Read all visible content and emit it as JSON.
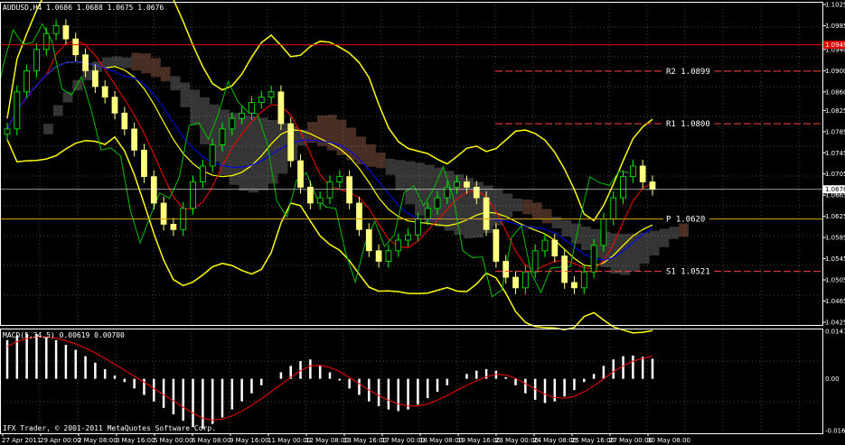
{
  "window": {
    "symbol_header": "AUDUSD,H4 1.0686 1.0688 1.0675 1.0676",
    "macd_header": "MACD(5,34,5) 0.00619 0.00700",
    "copyright": "IFX Trader, © 2001-2011 MetaQuotes Software Corp."
  },
  "colors": {
    "background": "#000000",
    "grid": "#ffffff",
    "bull_candle": "#000000",
    "bull_outline": "#00ff00",
    "bear_candle": "#ffff80",
    "bollinger": "#ffff00",
    "tenkan": "#ff0000",
    "kijun": "#0000ff",
    "chikou": "#00c000",
    "kumo_up": "#ffa07a",
    "kumo_down": "#c0c0c0",
    "resistance": "#ff4040",
    "pivot": "#d4a800",
    "current_price": "#ffffff",
    "red_level": "#e00000",
    "macd_hist": "#ffffff",
    "macd_signal": "#ff0000"
  },
  "pivots": [
    {
      "label": "R2",
      "value": "1.0899"
    },
    {
      "label": "R1",
      "value": "1.0800"
    },
    {
      "label": "P",
      "value": "1.0620"
    },
    {
      "label": "S1",
      "value": "1.0521"
    }
  ],
  "price_axis": {
    "ticks": [
      "1.1025",
      "1.0985",
      "1.0940",
      "1.0900",
      "1.0860",
      "1.0825",
      "1.0785",
      "1.0745",
      "1.0705",
      "1.0665",
      "1.0625",
      "1.0585",
      "1.0545",
      "1.0505",
      "1.0465",
      "1.0425"
    ],
    "current_price": "1.0676",
    "red_level_price": "1.0949"
  },
  "macd_axis": {
    "ticks": [
      "0.01473",
      "0.00",
      "-0.01604"
    ]
  },
  "time_axis": {
    "labels": [
      "27 Apr 2011",
      "29 Apr 00:00",
      "2 May 08:00",
      "3 May 16:00",
      "5 May 00:00",
      "6 May 08:00",
      "9 May 16:00",
      "11 May 00:00",
      "12 May 08:00",
      "13 May 16:00",
      "17 May 00:00",
      "18 May 08:00",
      "19 May 16:00",
      "23 May 00:00",
      "24 May 08:00",
      "25 May 16:00",
      "27 May 00:00",
      "30 May 08:00"
    ]
  },
  "chart_data": [
    {
      "type": "candlestick",
      "symbol": "AUDUSD",
      "timeframe": "H4",
      "ylim": [
        1.0425,
        1.1025
      ],
      "close_series": [
        1.079,
        1.086,
        1.09,
        1.094,
        1.097,
        1.0985,
        1.096,
        1.093,
        1.09,
        1.087,
        1.085,
        1.082,
        1.079,
        1.075,
        1.07,
        1.065,
        1.061,
        1.06,
        1.064,
        1.069,
        1.072,
        1.076,
        1.079,
        1.081,
        1.082,
        1.084,
        1.085,
        1.086,
        1.08,
        1.073,
        1.068,
        1.065,
        1.066,
        1.069,
        1.07,
        1.065,
        1.06,
        1.056,
        1.054,
        1.056,
        1.058,
        1.059,
        1.062,
        1.064,
        1.066,
        1.068,
        1.069,
        1.068,
        1.066,
        1.06,
        1.054,
        1.051,
        1.049,
        1.052,
        1.056,
        1.058,
        1.055,
        1.05,
        1.049,
        1.052,
        1.057,
        1.062,
        1.066,
        1.07,
        1.072,
        1.069,
        1.0676
      ],
      "pivots": {
        "R2": 1.0899,
        "R1": 1.08,
        "P": 1.062,
        "S1": 1.0521
      }
    },
    {
      "type": "bar",
      "title": "MACD(5,34,5)",
      "ylim": [
        -0.01604,
        0.01473
      ],
      "histogram": [
        0.012,
        0.0135,
        0.014,
        0.0138,
        0.013,
        0.012,
        0.0105,
        0.009,
        0.007,
        0.005,
        0.003,
        0.001,
        -0.001,
        -0.003,
        -0.005,
        -0.007,
        -0.009,
        -0.011,
        -0.013,
        -0.015,
        -0.0155,
        -0.014,
        -0.012,
        -0.0095,
        -0.007,
        -0.0045,
        -0.002,
        0.0,
        0.002,
        0.004,
        0.0055,
        0.006,
        0.004,
        0.002,
        -0.0005,
        -0.003,
        -0.005,
        -0.007,
        -0.0085,
        -0.0095,
        -0.01,
        -0.0095,
        -0.008,
        -0.006,
        -0.004,
        -0.002,
        0.0,
        0.0015,
        0.0025,
        0.003,
        0.0025,
        0.0005,
        -0.002,
        -0.0045,
        -0.0065,
        -0.0075,
        -0.007,
        -0.0055,
        -0.0035,
        -0.001,
        0.0015,
        0.004,
        0.006,
        0.007,
        0.0072,
        0.0068,
        0.0062
      ],
      "signal": [
        0.01,
        0.0115,
        0.0125,
        0.013,
        0.013,
        0.0126,
        0.0118,
        0.0108,
        0.0095,
        0.008,
        0.0063,
        0.0045,
        0.0027,
        0.0008,
        -0.001,
        -0.003,
        -0.005,
        -0.0068,
        -0.0088,
        -0.0106,
        -0.0122,
        -0.0128,
        -0.0125,
        -0.0115,
        -0.01,
        -0.0082,
        -0.0062,
        -0.004,
        -0.0018,
        0.0005,
        0.0025,
        0.004,
        0.0042,
        0.0035,
        0.0022,
        0.0005,
        -0.0015,
        -0.0035,
        -0.0052,
        -0.0066,
        -0.0078,
        -0.0084,
        -0.0084,
        -0.0078,
        -0.0066,
        -0.0052,
        -0.0036,
        -0.002,
        -0.0006,
        0.0006,
        0.0014,
        0.0012,
        0.0002,
        -0.0015,
        -0.0032,
        -0.0048,
        -0.0058,
        -0.006,
        -0.0054,
        -0.004,
        -0.0022,
        0.0,
        0.0022,
        0.004,
        0.0055,
        0.0063,
        0.007
      ]
    }
  ]
}
